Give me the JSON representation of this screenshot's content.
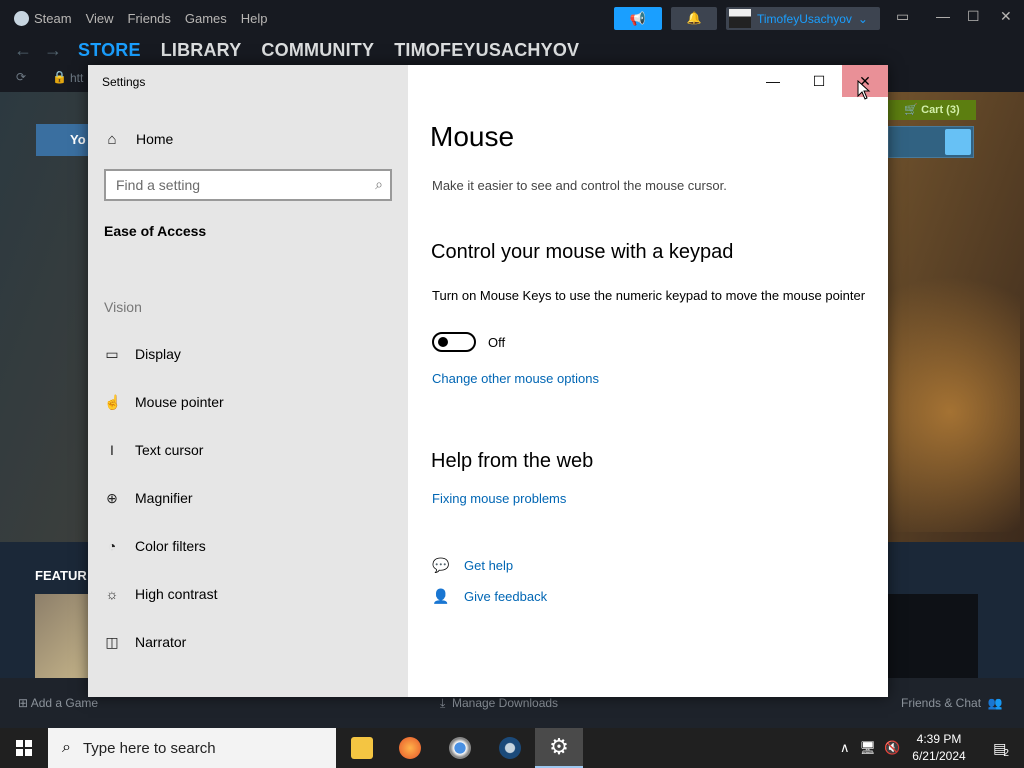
{
  "steam": {
    "menu": [
      "Steam",
      "View",
      "Friends",
      "Games",
      "Help"
    ],
    "username": "TimofeyUsachyov",
    "nav_tabs": [
      "STORE",
      "LIBRARY",
      "COMMUNITY",
      "TIMOFEYUSACHYOV"
    ],
    "url_text": "htt",
    "cart_label": "Cart (3)",
    "your_store_label": "Yo",
    "featured_label": "FEATUR",
    "add_game": "Add a Game",
    "manage_downloads": "Manage Downloads",
    "friends_chat": "Friends & Chat"
  },
  "settings": {
    "window_title": "Settings",
    "sidebar": {
      "home": "Home",
      "search_placeholder": "Find a setting",
      "section": "Ease of Access",
      "group": "Vision",
      "items": [
        {
          "label": "Display",
          "icon": "display-icon"
        },
        {
          "label": "Mouse pointer",
          "icon": "mouse-pointer-icon"
        },
        {
          "label": "Text cursor",
          "icon": "text-cursor-icon"
        },
        {
          "label": "Magnifier",
          "icon": "magnifier-icon"
        },
        {
          "label": "Color filters",
          "icon": "color-filters-icon"
        },
        {
          "label": "High contrast",
          "icon": "high-contrast-icon"
        },
        {
          "label": "Narrator",
          "icon": "narrator-icon"
        }
      ]
    },
    "content": {
      "title": "Mouse",
      "description": "Make it easier to see and control the mouse cursor.",
      "keypad_heading": "Control your mouse with a keypad",
      "keypad_description": "Turn on Mouse Keys to use the numeric keypad to move the mouse pointer",
      "toggle_state": "Off",
      "toggle_on": false,
      "other_options_link": "Change other mouse options",
      "help_heading": "Help from the web",
      "help_link": "Fixing mouse problems",
      "get_help": "Get help",
      "give_feedback": "Give feedback"
    }
  },
  "taskbar": {
    "search_placeholder": "Type here to search",
    "time": "4:39 PM",
    "date": "6/21/2024",
    "notification_count": "2"
  },
  "colors": {
    "accent_link": "#0066b4",
    "close_hover": "#e99097",
    "sidebar_bg": "#e6e6e6",
    "steam_blue": "#1a9fff"
  }
}
